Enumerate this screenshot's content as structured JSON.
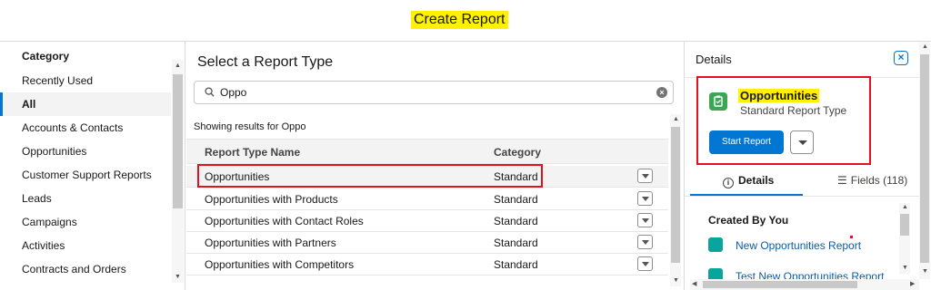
{
  "header": {
    "title": "Create Report"
  },
  "sidebar": {
    "heading": "Category",
    "items": [
      {
        "label": "Recently Used",
        "active": false
      },
      {
        "label": "All",
        "active": true
      },
      {
        "label": "Accounts & Contacts",
        "active": false
      },
      {
        "label": "Opportunities",
        "active": false
      },
      {
        "label": "Customer Support Reports",
        "active": false
      },
      {
        "label": "Leads",
        "active": false
      },
      {
        "label": "Campaigns",
        "active": false
      },
      {
        "label": "Activities",
        "active": false
      },
      {
        "label": "Contracts and Orders",
        "active": false
      }
    ]
  },
  "main": {
    "title": "Select a Report Type",
    "search": {
      "value": "Oppo",
      "icon": "search-icon",
      "clear_icon": "clear-icon"
    },
    "results_text": "Showing results for Oppo",
    "columns": [
      "Report Type Name",
      "Category"
    ],
    "rows": [
      {
        "name": "Opportunities",
        "category": "Standard",
        "selected": true
      },
      {
        "name": "Opportunities with Products",
        "category": "Standard",
        "selected": false
      },
      {
        "name": "Opportunities with Contact Roles",
        "category": "Standard",
        "selected": false
      },
      {
        "name": "Opportunities with Partners",
        "category": "Standard",
        "selected": false
      },
      {
        "name": "Opportunities with Competitors",
        "category": "Standard",
        "selected": false
      }
    ]
  },
  "details": {
    "title": "Details",
    "report_type": {
      "name": "Opportunities",
      "subtitle": "Standard Report Type",
      "icon": "opportunity-icon"
    },
    "start_button": "Start Report",
    "tabs": {
      "details": "Details",
      "fields": "Fields (118)"
    },
    "created_heading": "Created By You",
    "reports": [
      "New Opportunities Report",
      "Test New Opportunities Report"
    ]
  },
  "colors": {
    "highlight": "#fff100",
    "accent": "#0176d3",
    "annotation_red": "#e3111f",
    "opportunity_green": "#3ba755",
    "report_teal": "#07a59b"
  }
}
